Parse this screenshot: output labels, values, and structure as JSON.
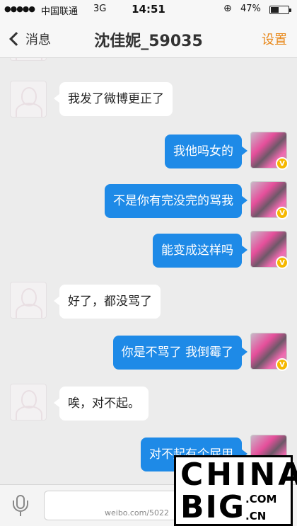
{
  "status_bar": {
    "signal": "●●●●●",
    "carrier": "中国联通",
    "network": "3G",
    "time": "14:51",
    "lock_icon": "orientation-lock-icon",
    "battery_percent": "47%",
    "battery_level": 0.47
  },
  "nav": {
    "back_label": "消息",
    "title": "沈佳妮_59035",
    "settings_label": "设置",
    "accent_color": "#e8891c"
  },
  "messages": [
    {
      "sender": "other",
      "text": "我发了微博更正了"
    },
    {
      "sender": "me",
      "text": "我他吗女的"
    },
    {
      "sender": "me",
      "text": "不是你有完没完的骂我"
    },
    {
      "sender": "me",
      "text": "能变成这样吗"
    },
    {
      "sender": "other",
      "text": "好了，都没骂了"
    },
    {
      "sender": "me",
      "text": "你是不骂了 我倒霉了"
    },
    {
      "sender": "other",
      "text": "唉，对不起。"
    },
    {
      "sender": "me",
      "text": "对不起有个屁用"
    }
  ],
  "colors": {
    "my_bubble": "#1e8ae7",
    "other_bubble": "#ffffff",
    "background": "#ececec"
  },
  "watermark": {
    "weibo_text": "weibo.com/5022"
  },
  "logo": {
    "line1": "CHINA",
    "line2": "BIG",
    "suffix1": ".COM",
    "suffix2": ".CN"
  }
}
